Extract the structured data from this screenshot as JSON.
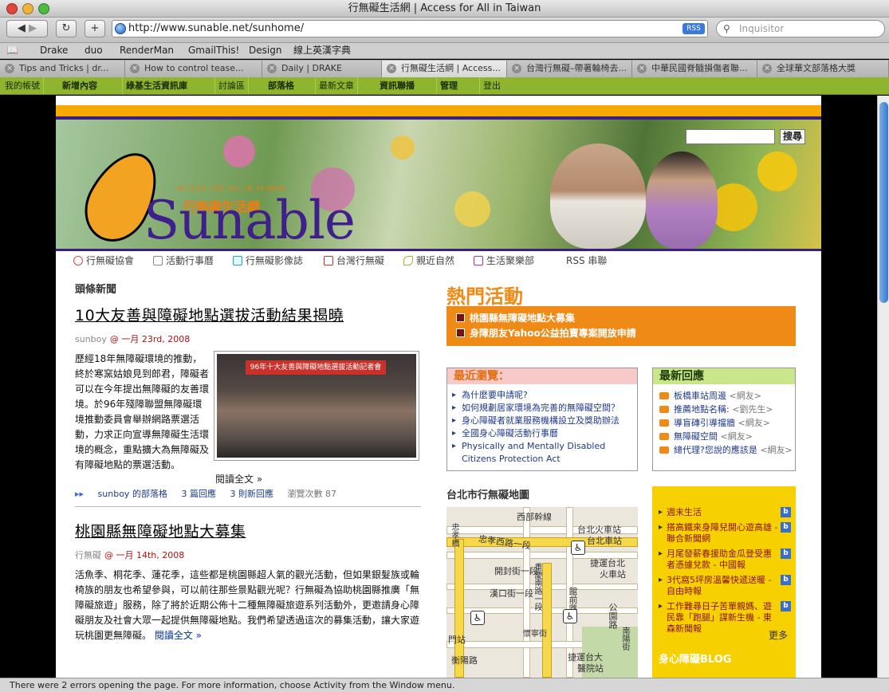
{
  "window": {
    "title": "行無礙生活網 | Access for All in Taiwan"
  },
  "toolbar": {
    "url": "http://www.sunable.net/sunhome/",
    "rss": "RSS",
    "search_placeholder": "Inquisitor"
  },
  "bookmarks": [
    "Drake",
    "duo",
    "RenderMan",
    "GmailThis!",
    "Design",
    "線上英漢字典"
  ],
  "tabs": [
    {
      "label": "Tips and Tricks | dr...",
      "active": false
    },
    {
      "label": "How to control tease...",
      "active": false
    },
    {
      "label": "Daily | DRAKE",
      "active": false
    },
    {
      "label": "行無礙生活網 | Access...",
      "active": true
    },
    {
      "label": "台灣行無礙–帶著輪椅去...",
      "active": false
    },
    {
      "label": "中華民國脊髓損傷者聯...",
      "active": false
    },
    {
      "label": "全球華文部落格大獎",
      "active": false
    }
  ],
  "sitenav": [
    "我的帳號",
    "新增內容",
    "綠基生活資訊庫",
    "討論區",
    "部落格",
    "最新文章",
    "資訊聯播",
    "管理",
    "登出"
  ],
  "banner": {
    "logo": "Sunable",
    "logo_zh": "行無礙生活網",
    "logo_en": "ACCESS FOR ALL IN TAIWAN",
    "search_button": "搜尋"
  },
  "categories": [
    "行無礙協會",
    "活動行事曆",
    "行無礙影像誌",
    "台灣行無礙",
    "親近自然",
    "生活聚樂部",
    "RSS 串聯"
  ],
  "headline": {
    "section": "頭條新聞",
    "title": "10大友善與障礙地點選拔活動結果揭曉",
    "author": "sunboy",
    "date": "@ 一月 23rd, 2008",
    "body": "歷經18年無障礙環境的推動，終於寒窯姑娘見到郎君，障礙者可以在今年提出無障礙的友善環境。於96年殘障聯盟無障礙環境推動委員會舉辦網路票選活動，力求正向宣導無障礙生活環境的概念，重點擴大為無障礙及有障礙地點的票選活動。",
    "read_more": "閱讀全文 »",
    "photo_caption": "96年十大友善與障礙地點選拔活動記者會",
    "foot": {
      "blog": "sunboy 的部落格",
      "replies": "3 篇回應",
      "new": "3 則新回應",
      "views": "瀏覽次數 87"
    }
  },
  "article2": {
    "title": "桃園縣無障礙地點大募集",
    "author": "行無礙",
    "date": "@ 一月 14th, 2008",
    "body": "活魚季、桐花季、蓮花季，這些都是桃園縣超人氣的觀光活動，但如果銀髮族或輪椅族的朋友也希望參與，可以前往那些景點觀光呢？行無礙為協助桃園縣推廣「無障礙旅遊」服務，除了將於近期公佈十二種無障礙旅遊系列活動外，更邀請身心障礙朋友及社會大眾一起提供無障礙地點。我們希望透過這次的募集活動，讓大家遊玩桃園更無障礙。",
    "read_more": "閱讀全文 »"
  },
  "hot": {
    "title": "熱門活動",
    "items": [
      "桃園縣無障礙地點大募集",
      "身障朋友Yahoo公益拍賣專案開放申請"
    ]
  },
  "recent": {
    "title": "最近瀏覽：",
    "items": [
      "為什麼要申請呢?",
      "如何規劃居家環境為完善的無障礙空間？",
      "身心障礙者就業服務機構設立及獎助辦法",
      "全國身心障礙活動行事曆",
      "Physically and Mentally Disabled Citizens Protection Act"
    ]
  },
  "replies": {
    "title": "最新回應",
    "items": [
      {
        "text": "板橋車站周邊",
        "who": "<網友>"
      },
      {
        "text": "推薦地點名稱:",
        "who": "<劉先生>"
      },
      {
        "text": "導盲磚引導擋牆",
        "who": "<網友>"
      },
      {
        "text": "無障礙空間",
        "who": "<網友>"
      },
      {
        "text": "總代理?您說的應該是",
        "who": "<網友>"
      }
    ]
  },
  "map": {
    "title": "台北市行無礙地圖",
    "labels": [
      "西部幹線",
      "忠孝西路一段",
      "台北火車站",
      "台北車站",
      "開封街一段",
      "漢口街一段",
      "捷運台北",
      "火車站",
      "館前路",
      "公園路",
      "衡陽路",
      "捷運台大",
      "醫院站",
      "門站",
      "忠孝橋",
      "重慶南路一段",
      "懷寧街",
      "南陽街"
    ]
  },
  "blog": {
    "items": [
      "週末生活",
      "搭高鐵來身障兒開心遊高雄 - 聯合新聞網",
      "月尾發薪春援助金瓜登受惠者憑據兌款 - 中國報",
      "3代窩5坪房溫馨快遞送暖 - 自由時報",
      "工作難尋日子苦單親媽、遊民靠「跑腿」謀新生機 - 東森新聞報"
    ],
    "more": "更多",
    "footer": "身心障礙BLOG"
  },
  "status": "There were 2 errors opening the page. For more information, choose Activity from the Window menu.",
  "colors": {
    "accent_orange": "#f08a16",
    "brand_purple": "#3e1f8c",
    "nav_green": "#8fb52f"
  }
}
